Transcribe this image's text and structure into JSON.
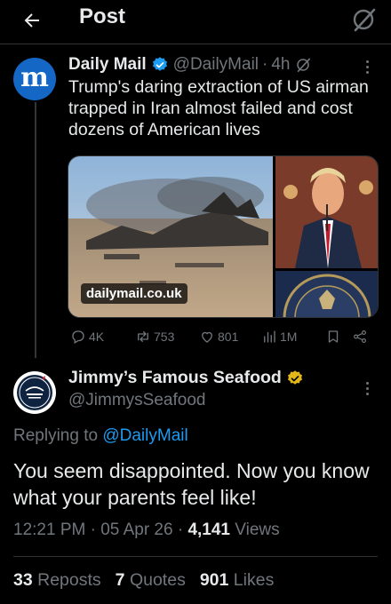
{
  "header": {
    "title": "Post",
    "back_icon": "arrow-left-icon",
    "right_icon": "grok-icon"
  },
  "original_tweet": {
    "author_name": "Daily Mail",
    "author_handle": "@DailyMail",
    "separator": "·",
    "time": "4h",
    "text": "Trump's daring extraction of US airman trapped in Iran almost failed and cost dozens of American lives",
    "media_source": "dailymail.co.uk",
    "replies": "4K",
    "reposts": "753",
    "likes": "801",
    "views": "1M",
    "avatar_letter": "m"
  },
  "reply": {
    "author_name": "Jimmy’s Famous Seafood",
    "author_handle": "@JimmysSeafood",
    "replying_prefix": "Replying to",
    "replying_to": "@DailyMail",
    "text": "You seem disappointed. Now you know what your parents feel like!",
    "time": "12:21 PM",
    "date": "05 Apr 26",
    "dot": "·",
    "views_count": "4,141",
    "views_label": "Views",
    "reposts_count": "33",
    "reposts_label": "Reposts",
    "quotes_count": "7",
    "quotes_label": "Quotes",
    "likes_count": "901",
    "likes_label": "Likes"
  },
  "colors": {
    "accent": "#1d9bf0",
    "gold_badge": "#e2b719",
    "muted": "#71767b",
    "background": "#000000"
  }
}
